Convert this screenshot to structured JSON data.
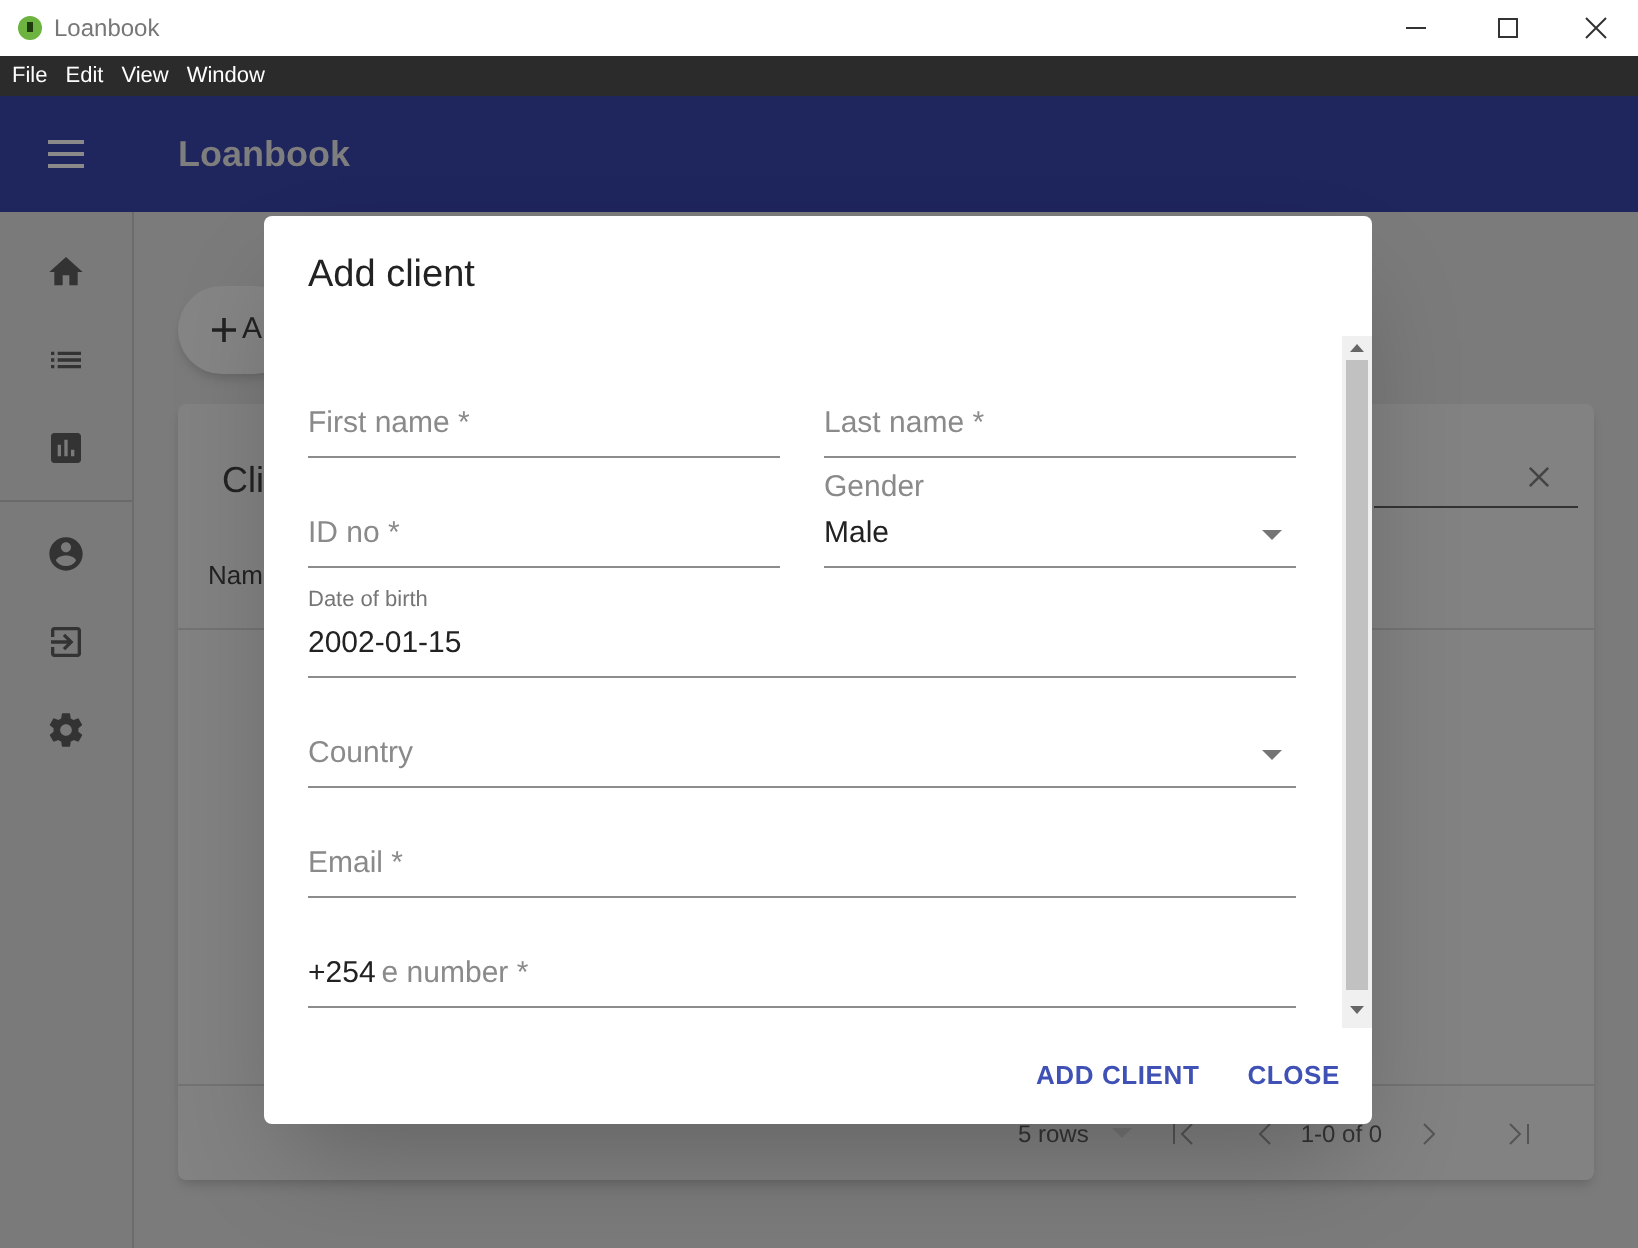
{
  "window": {
    "title": "Loanbook"
  },
  "menu": [
    "File",
    "Edit",
    "View",
    "Window"
  ],
  "app_bar": {
    "title": "Loanbook"
  },
  "page": {
    "add_button": "A",
    "card_title": "Cli",
    "columns": [
      "Nam"
    ],
    "footer": {
      "rows_per_page": "5 rows",
      "range": "1-0 of 0"
    }
  },
  "dialog": {
    "title": "Add client",
    "rows": [
      [
        {
          "kind": "text",
          "label": "First name *"
        },
        {
          "kind": "text",
          "label": "Last name *"
        }
      ],
      [
        {
          "kind": "text",
          "label": "ID no *"
        },
        {
          "kind": "select",
          "label": "Gender",
          "value": "Male"
        }
      ],
      [
        {
          "kind": "date",
          "label": "Date of birth",
          "value": "2002-01-15"
        }
      ],
      [
        {
          "kind": "select",
          "label": "Country"
        }
      ],
      [
        {
          "kind": "text",
          "label": "Email *"
        }
      ],
      [
        {
          "kind": "text",
          "label": "e number *",
          "value": "+254"
        }
      ]
    ],
    "buttons": [
      "ADD CLIENT",
      "CLOSE"
    ]
  }
}
